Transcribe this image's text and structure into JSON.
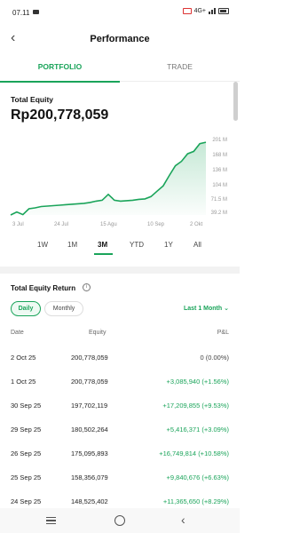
{
  "status_bar": {
    "time": "07.11",
    "signal_text": "4G+"
  },
  "header": {
    "back_icon": "chevron-left-icon",
    "title": "Performance"
  },
  "tabs": [
    {
      "label": "PORTFOLIO",
      "active": true
    },
    {
      "label": "TRADE",
      "active": false
    }
  ],
  "equity": {
    "label": "Total Equity",
    "value": "Rp200,778,059"
  },
  "chart_data": {
    "type": "area",
    "color": "#1aa45a",
    "y_ticks": [
      "201 M",
      "168 M",
      "136 M",
      "104 M",
      "71.5 M",
      "39.2 M"
    ],
    "x_ticks": [
      "3 Jul",
      "24 Jul",
      "15 Agu",
      "10 Sep",
      "2 Okt"
    ],
    "series": [
      {
        "values": [
          39.2,
          46,
          40,
          53,
          55,
          58,
          59,
          60,
          61,
          62,
          63,
          64,
          65,
          67,
          70,
          72,
          85,
          72,
          70,
          71,
          72,
          74,
          75,
          80,
          92,
          104,
          127,
          148.5,
          158.4,
          175.1,
          180.5,
          197.7,
          200.8
        ]
      }
    ]
  },
  "ranges": [
    {
      "label": "1W",
      "active": false
    },
    {
      "label": "1M",
      "active": false
    },
    {
      "label": "3M",
      "active": true
    },
    {
      "label": "YTD",
      "active": false
    },
    {
      "label": "1Y",
      "active": false
    },
    {
      "label": "All",
      "active": false
    }
  ],
  "returns": {
    "title": "Total Equity Return",
    "info_icon": "info-icon",
    "segments": [
      {
        "label": "Daily",
        "active": true
      },
      {
        "label": "Monthly",
        "active": false
      }
    ],
    "period_label": "Last 1 Month",
    "columns": [
      "Date",
      "Equity",
      "P&L"
    ],
    "rows": [
      [
        "2 Oct 25",
        "200,778,059",
        "0 (0.00%)"
      ],
      [
        "1 Oct 25",
        "200,778,059",
        "+3,085,940 (+1.56%)"
      ],
      [
        "30 Sep 25",
        "197,702,119",
        "+17,209,855 (+9.53%)"
      ],
      [
        "29 Sep 25",
        "180,502,264",
        "+5,416,371 (+3.09%)"
      ],
      [
        "26 Sep 25",
        "175,095,893",
        "+16,749,814 (+10.58%)"
      ],
      [
        "25 Sep 25",
        "158,356,079",
        "+9,840,676 (+6.63%)"
      ],
      [
        "24 Sep 25",
        "148,525,402",
        "+11,365,650 (+8.29%)"
      ]
    ]
  },
  "nav": {
    "menu_icon": "recent-apps-icon",
    "home_icon": "home-icon",
    "back_icon": "back-icon"
  }
}
